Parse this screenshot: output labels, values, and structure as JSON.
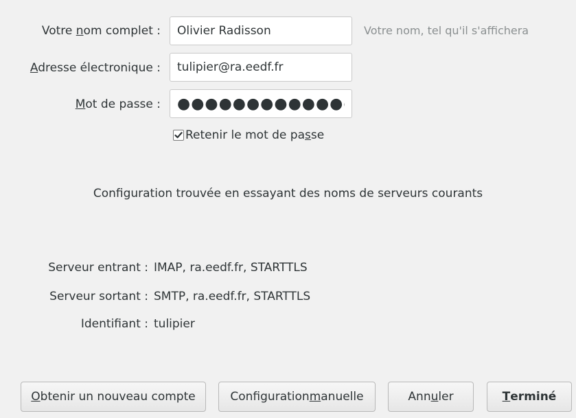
{
  "form": {
    "name": {
      "label_before": "Votre ",
      "label_mnemonic": "n",
      "label_after": "om complet :",
      "value": "Olivier Radisson",
      "hint": "Votre nom, tel qu'il s'affichera"
    },
    "email": {
      "label_before": "",
      "label_mnemonic": "A",
      "label_after": "dresse électronique :",
      "value": "tulipier@ra.eedf.fr"
    },
    "password": {
      "label_before": "",
      "label_mnemonic": "M",
      "label_after": "ot de passe :",
      "value": "●●●●●●●●●●●●●●●●"
    },
    "remember": {
      "label_before": "Retenir le mot de pa",
      "label_mnemonic": "s",
      "label_after": "se",
      "checked": true
    }
  },
  "status": {
    "message": "Configuration trouvée en essayant des noms de serveurs courants"
  },
  "servers": {
    "incoming": {
      "label": "Serveur entrant :",
      "value": "IMAP, ra.eedf.fr, STARTTLS"
    },
    "outgoing": {
      "label": "Serveur sortant :",
      "value": "SMTP, ra.eedf.fr, STARTTLS"
    },
    "username": {
      "label": "Identifiant :",
      "value": "tulipier"
    }
  },
  "buttons": {
    "new_account": {
      "mnemonic": "O",
      "after": "btenir un nouveau compte"
    },
    "manual_config": {
      "before": "Configuration ",
      "mnemonic": "m",
      "after": "anuelle"
    },
    "cancel": {
      "before": "Ann",
      "mnemonic": "u",
      "after": "ler"
    },
    "done": {
      "mnemonic": "T",
      "after": "erminé"
    }
  }
}
